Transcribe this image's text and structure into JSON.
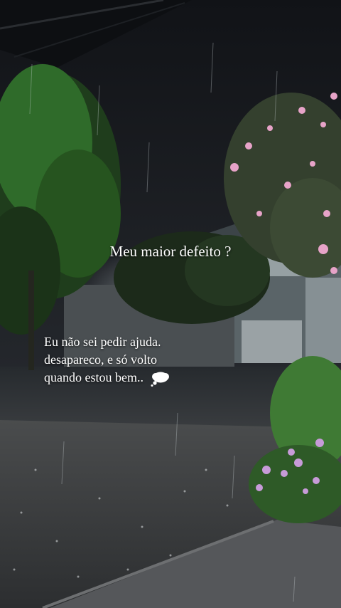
{
  "overlay": {
    "question": "Meu maior defeito ?",
    "lines": [
      "Eu não sei pedir ajuda.",
      "desapareco, e só volto",
      "quando estou bem.."
    ],
    "emoji": "thought-balloon-icon"
  },
  "colors": {
    "sky": "#16181d",
    "ground": "#3a3c3e",
    "foliage": "#2f6b2a",
    "blossom": "#e7a3c8"
  }
}
